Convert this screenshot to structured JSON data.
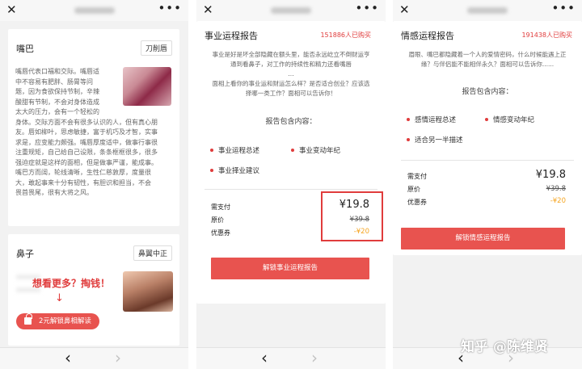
{
  "topbar": {
    "close_glyph": "✕",
    "more_glyph": "•••"
  },
  "bottombar": {
    "back_glyph": "‹",
    "forward_glyph": "›"
  },
  "panel1": {
    "lips": {
      "title": "嘴巴",
      "tag": "刀削唇",
      "lines_left": [
        "嘴唇代表口福和交际。嘴唇适",
        "中不容易有肥胖、肠胃等问",
        "题，因为食欲保持节制，辛辣",
        "酸甜有节制，不会对身体造成",
        "太大的压力，会有一个轻松的"
      ],
      "lines_full": [
        "身体。交际方面不会有很多认识的人，但有真心朋",
        "友。唇如柳叶，思虑敏捷，富于机巧及才智，实事",
        "求是，应变能力颇强。嘴唇厚度适中，做事行事很",
        "注重规矩，自己给自己设限，条条框框很多，很多",
        "强迫症就是这样的面相，但是做事严谨，能成事。",
        "嘴巴方而阔，轮线清晰，生性仁慈敦厚，度量很",
        "大，敢起事来十分有韧性，有胆识和担当，不会",
        "畏首畏尾，很有大将之风。"
      ]
    },
    "nose": {
      "title": "鼻子",
      "tag": "鼻翼中正",
      "promo": "想看更多？掏钱！",
      "unlock_label": "2元解锁鼻相解读"
    }
  },
  "panel2": {
    "title": "事业运程报告",
    "buyers": "151886人已购买",
    "desc1": "事业是好是坏全部隐藏在额头里，能否永远屹立不倒财运亨",
    "desc2": "通到看鼻子，对工作的持续性和精力还看嘴唇",
    "ellipsis": "...",
    "desc3": "面相上看你的事业运和财运怎么样？是否适合创业？应该选",
    "desc4": "择哪一类工作？面相可以告诉你！",
    "includes_heading": "报告包含内容：",
    "items": [
      "事业运程总述",
      "事业变动年纪",
      "事业择业建议"
    ],
    "price_label": "需支付",
    "price": "¥19.8",
    "original_label": "原价",
    "original_price": "¥39.8",
    "coupon_label": "优惠券",
    "coupon_value": "-¥20",
    "unlock_button": "解锁事业运程报告"
  },
  "panel3": {
    "title": "情感运程报告",
    "buyers": "191438人已购买",
    "desc1": "眉眼、嘴巴都隐藏着一个人的爱情密码，什么时候能遇上正",
    "desc2": "缘？与伴侣能不能相伴永久？面相可以告诉你......",
    "includes_heading": "报告包含内容：",
    "items": [
      "感情运程总述",
      "情感变动年纪",
      "适合另一半描述"
    ],
    "price_label": "需支付",
    "price": "¥19.8",
    "original_label": "原价",
    "original_price": "¥39.8",
    "coupon_label": "优惠券",
    "coupon_value": "-¥20",
    "unlock_button": "解锁情感运程报告"
  },
  "watermark": "知乎 @陈维贤",
  "colors": {
    "accent": "#e8534f",
    "promo_red": "#e03c3c",
    "coupon_orange": "#f5a623"
  }
}
